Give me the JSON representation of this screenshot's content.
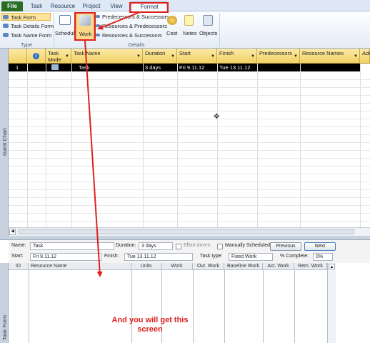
{
  "ribbon": {
    "tabs": [
      "File",
      "Task",
      "Resource",
      "Project",
      "View",
      "Format"
    ],
    "type_group": {
      "items": [
        "Task Form",
        "Task Details Form",
        "Task Name Form"
      ],
      "label": "Type"
    },
    "details_group": {
      "label": "Details",
      "schedule": "Schedule",
      "work": "Work",
      "items": [
        "Predecessors & Successors",
        "Resources & Predecessors",
        "Resources & Successors"
      ],
      "cost": "Cost",
      "notes": "Notes",
      "objects": "Objects"
    }
  },
  "side_labels": {
    "top": "Gantt Chart",
    "bottom": "Task Form"
  },
  "grid": {
    "columns": [
      "Task Mode",
      "Task Name",
      "Duration",
      "Start",
      "Finish",
      "Predecessors",
      "Resource Names",
      "Add"
    ],
    "rows": [
      {
        "id": "1",
        "name": "Task",
        "duration": "3 days",
        "start": "Fri 9.11.12",
        "finish": "Tue 13.11.12"
      }
    ]
  },
  "form": {
    "name_label": "Name:",
    "name_value": "Task",
    "duration_label": "Duration:",
    "duration_value": "3 days",
    "effort_label": "Effort driven",
    "manual_label": "Manually Scheduled",
    "prev_label": "Previous",
    "next_label": "Next",
    "start_label": "Start:",
    "start_value": "Fri 9.11.12",
    "finish_label": "Finish:",
    "finish_value": "Tue 13.11.12",
    "tasktype_label": "Task type:",
    "tasktype_value": "Fixed Work",
    "complete_label": "% Complete:",
    "complete_value": "0%"
  },
  "resource_table": {
    "columns": [
      "ID",
      "Resource Name",
      "Units",
      "Work",
      "Ovt. Work",
      "Baseline Work",
      "Act. Work",
      "Rem. Work"
    ]
  },
  "annotation": {
    "text": "And you will get this screen",
    "color": "#e02020"
  }
}
